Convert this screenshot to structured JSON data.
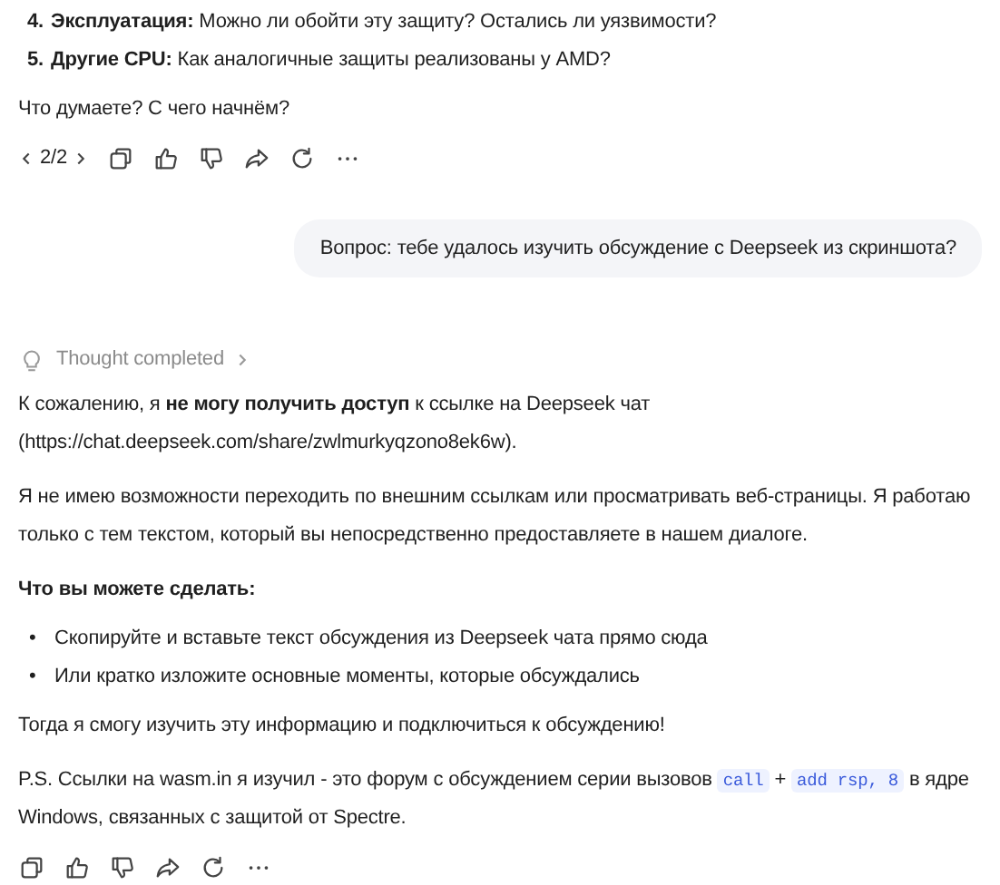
{
  "top_message": {
    "list_items": [
      {
        "number": "4.",
        "text": "**Эксплуатация:** Можно ли обойти эту защиту? Остались ли уязвимости?"
      },
      {
        "number": "5.",
        "text": "**Другие CPU:** Как аналогичные защиты реализованы у AMD?"
      }
    ],
    "closing": "Что думаете? С чего начнём?",
    "actions": {
      "pager": "2/2"
    }
  },
  "user_message": "Вопрос: тебе удалось изучить обсуждение с Deepseek из скриншота?",
  "reply": {
    "thought": "Thought completed",
    "paragraphs": [
      {
        "kind": "text",
        "text": "К сожалению, я **не могу получить доступ** к ссылке на Deepseek чат (https://chat.deepseek.com/share/zwlmurkyqzono8ek6w)."
      },
      {
        "kind": "text",
        "text": "Я не имею возможности переходить по внешним ссылкам или просматривать веб-страницы. Я работаю только с тем текстом, который вы непосредственно предоставляете в нашем диалоге."
      },
      {
        "kind": "heading",
        "text": "Что вы можете сделать:"
      },
      {
        "kind": "bullets",
        "items": [
          {
            "marker": "•",
            "text": "Скопируйте и вставьте текст обсуждения из Deepseek чата прямо сюда"
          },
          {
            "marker": "•",
            "text": "Или кратко изложите основные моменты, которые обсуждались"
          }
        ]
      },
      {
        "kind": "text",
        "text": "Тогда я смогу изучить эту информацию и подключиться к обсуждению!"
      },
      {
        "kind": "mixed",
        "parts": [
          {
            "kind": "text",
            "text": "P.S. Ссылки на wasm.in я изучил - это форум с обсуждением серии вызовов "
          },
          {
            "kind": "code",
            "text": "call"
          },
          {
            "kind": "text",
            "text": " + "
          },
          {
            "kind": "code",
            "text": "add rsp, 8"
          },
          {
            "kind": "text",
            "text": " в ядре Windows, связанных с защитой от Spectre."
          }
        ]
      }
    ]
  }
}
